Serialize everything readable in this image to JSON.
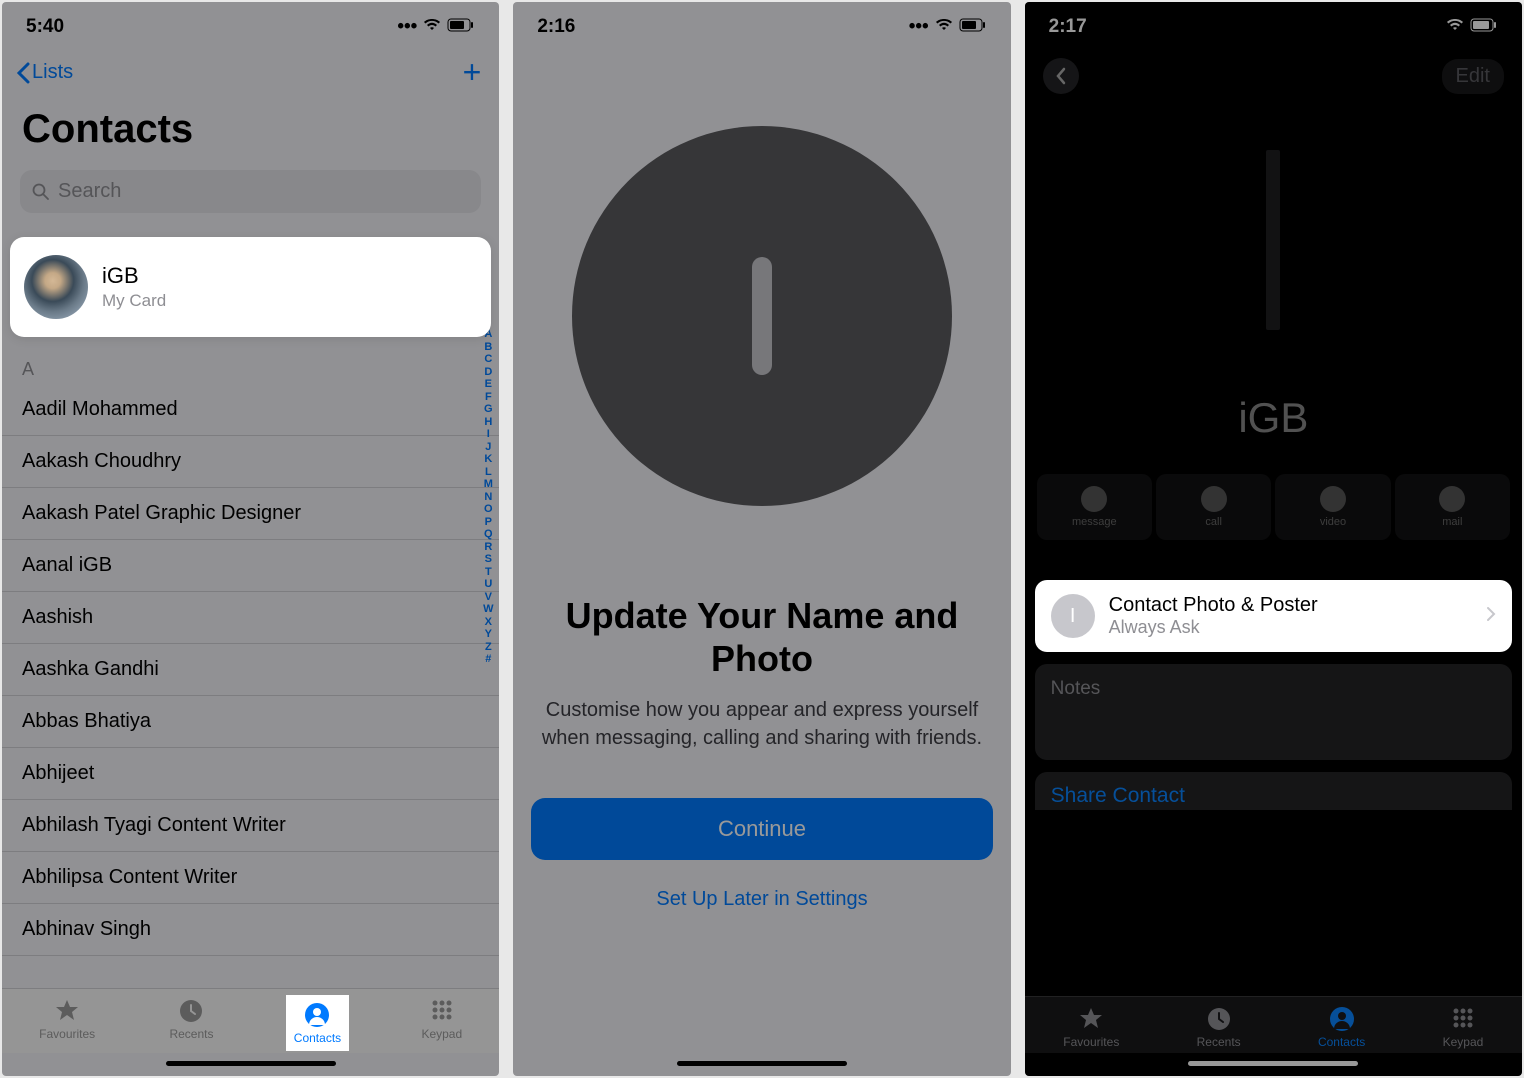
{
  "screen1": {
    "time": "5:40",
    "back_label": "Lists",
    "title": "Contacts",
    "search_placeholder": "Search",
    "my_card": {
      "name": "iGB",
      "sub": "My Card"
    },
    "section": "A",
    "contacts": [
      "Aadil Mohammed",
      "Aakash Choudhry",
      "Aakash Patel Graphic Designer",
      "Aanal iGB",
      "Aashish",
      "Aashka Gandhi",
      "Abbas Bhatiya",
      "Abhijeet",
      "Abhilash Tyagi Content Writer",
      "Abhilipsa Content Writer",
      "Abhinav Singh"
    ],
    "index": [
      "A",
      "B",
      "C",
      "D",
      "E",
      "F",
      "G",
      "H",
      "I",
      "J",
      "K",
      "L",
      "M",
      "N",
      "O",
      "P",
      "Q",
      "R",
      "S",
      "T",
      "U",
      "V",
      "W",
      "X",
      "Y",
      "Z",
      "#"
    ],
    "tabs": {
      "favourites": "Favourites",
      "recents": "Recents",
      "contacts": "Contacts",
      "keypad": "Keypad"
    }
  },
  "screen2": {
    "time": "2:16",
    "title": "Update Your Name and Photo",
    "desc": "Customise how you appear and express yourself when messaging, calling and sharing with friends.",
    "continue": "Continue",
    "later": "Set Up Later in Settings"
  },
  "screen3": {
    "time": "2:17",
    "edit": "Edit",
    "poster_name": "iGB",
    "actions": {
      "message": "message",
      "call": "call",
      "video": "video",
      "mail": "mail"
    },
    "cpp": {
      "initial": "I",
      "title": "Contact Photo & Poster",
      "sub": "Always Ask"
    },
    "notes": "Notes",
    "share": "Share Contact",
    "tabs": {
      "favourites": "Favourites",
      "recents": "Recents",
      "contacts": "Contacts",
      "keypad": "Keypad"
    }
  }
}
